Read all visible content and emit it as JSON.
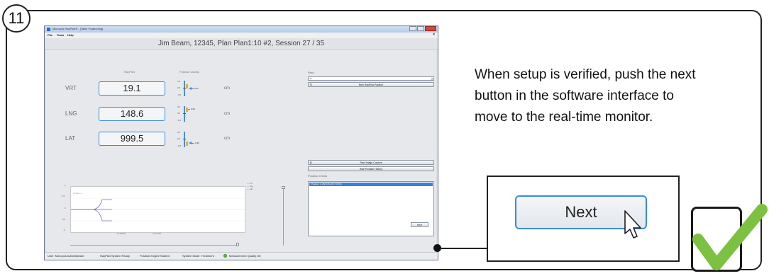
{
  "step_number": "11",
  "instruction": "When setup is verified, push the next button in the software interface to move to the real-time monitor.",
  "window": {
    "title": "Micropos RayPilot® - [Table Positioning]",
    "menu": [
      "File",
      "Tools",
      "Help"
    ],
    "close_x": "×",
    "header": "Jim Beam, 12345, Plan Plan1:10 #2, Session 27 / 35"
  },
  "readout": {
    "col_raypilot": "RayPilot",
    "col_validity": "Position validity",
    "rows": [
      {
        "axis": "VRT",
        "value": "19.1",
        "unit": "cm",
        "gauge_value": "0.02",
        "ticks": [
          "0.5",
          "0.0",
          "-0.5"
        ]
      },
      {
        "axis": "LNG",
        "value": "148.6",
        "unit": "cm",
        "gauge_value": "0.09",
        "ticks": [
          "0.5",
          "0.0",
          "-0.5"
        ]
      },
      {
        "axis": "LAT",
        "value": "999.5",
        "unit": "cm",
        "gauge_value": "-0.36",
        "ticks": [
          "0.5",
          "0.0",
          "-0.5"
        ]
      }
    ]
  },
  "chart_data": {
    "type": "line",
    "title": "",
    "annotation": "Position 1",
    "x_tick_labels": [
      "17:06:30",
      "17:07:00"
    ],
    "y_tick_labels": [
      "1",
      "0.5",
      "0",
      "-0.5",
      "-1"
    ],
    "ylim": [
      -1,
      1
    ],
    "series": [
      {
        "name": "Vrt",
        "color": "#7a6fbf"
      },
      {
        "name": "Lng",
        "color": "#7a6fbf"
      },
      {
        "name": "Lat",
        "color": "#7a6fbf"
      }
    ]
  },
  "right_panel": {
    "field_label": "Field",
    "field_value": "f1",
    "new_position_button": "New RayPilot Position",
    "start_capture_button": "Start Image Capture",
    "hide_history_button": "Hide Position History",
    "events_label": "Position events",
    "events": [
      "Position 1, 2020-06-24 17:06:53"
    ]
  },
  "small_next_label": "Next",
  "statusbar": {
    "user": "User: Micropos Administrator",
    "system": "RayPilot System Ready",
    "engine": "Position Engine Started",
    "mode": "System Mode: Treatment",
    "quality": "Measurement Quality OK"
  },
  "callout_next_label": "Next",
  "colors": {
    "accent": "#3c8bd8",
    "check": "#7cc142",
    "status_ok": "#5cbf3a"
  }
}
